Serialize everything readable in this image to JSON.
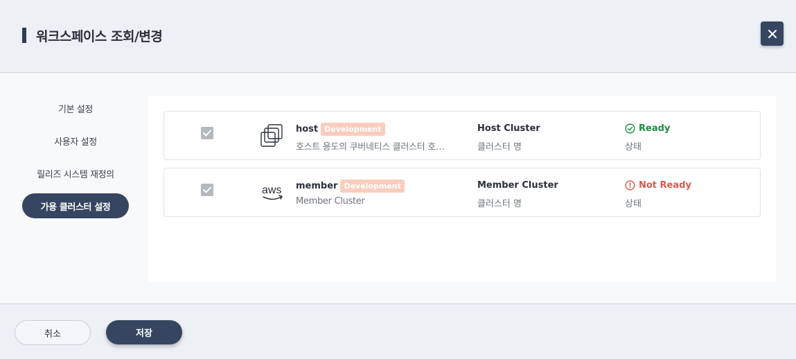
{
  "header": {
    "title": "워크스페이스 조회/변경",
    "close_icon": "close-icon"
  },
  "sidebar": {
    "items": [
      {
        "label": "기본 설정",
        "active": false
      },
      {
        "label": "사용자 설정",
        "active": false
      },
      {
        "label": "릴리즈 시스템 재정의",
        "active": false
      },
      {
        "label": "가용 클러스터 설정",
        "active": true
      }
    ]
  },
  "clusters": [
    {
      "checked": true,
      "logo_icon": "cluster-stack-icon",
      "name": "host",
      "badge": "Development",
      "description": "호스트 용도의 쿠버네티스 클러스터 호…",
      "cluster_name": "Host Cluster",
      "cluster_name_label": "클러스터 명",
      "status": "Ready",
      "status_icon": "check-circle-icon",
      "status_label": "상태"
    },
    {
      "checked": true,
      "logo_icon": "aws-logo-icon",
      "logo_text": "aws",
      "name": "member",
      "badge": "Development",
      "description": "Member Cluster",
      "cluster_name": "Member Cluster",
      "cluster_name_label": "클러스터 명",
      "status": "Not Ready",
      "status_icon": "alert-circle-icon",
      "status_label": "상태"
    }
  ],
  "footer": {
    "cancel_label": "취소",
    "save_label": "저장"
  },
  "colors": {
    "primary": "#364560",
    "badge": "#f9cdbd",
    "ready": "#1e8a47",
    "not_ready": "#d9594a",
    "checkbox": "#b4b8bf"
  }
}
